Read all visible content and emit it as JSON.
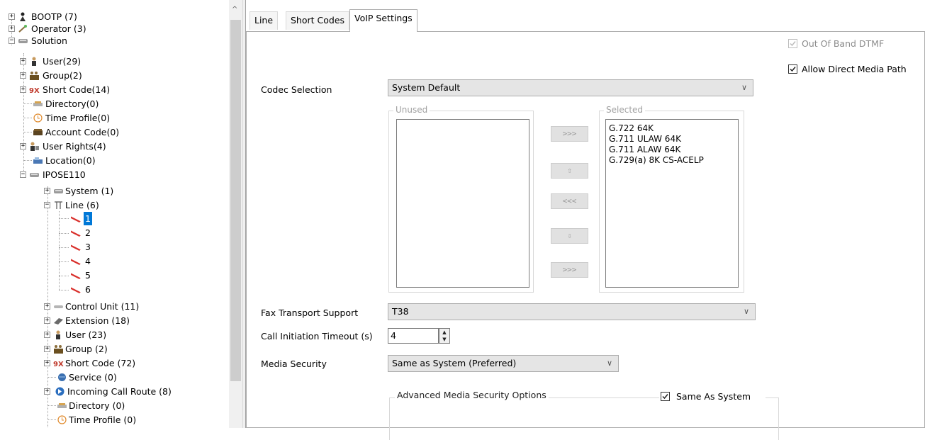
{
  "tree": {
    "root_items": [
      {
        "label": "BOOTP (7)",
        "icon": "bootp-icon"
      },
      {
        "label": "Operator (3)",
        "icon": "operator-icon"
      },
      {
        "label": "Solution",
        "icon": "solution-icon"
      }
    ],
    "solution_children": [
      {
        "label": "User(29)",
        "icon": "user-icon"
      },
      {
        "label": "Group(2)",
        "icon": "group-icon"
      },
      {
        "label": "Short Code(14)",
        "icon": "short-code-icon"
      },
      {
        "label": "Directory(0)",
        "icon": "directory-icon"
      },
      {
        "label": "Time Profile(0)",
        "icon": "time-profile-icon"
      },
      {
        "label": "Account Code(0)",
        "icon": "account-code-icon"
      },
      {
        "label": "User Rights(4)",
        "icon": "user-rights-icon"
      },
      {
        "label": "Location(0)",
        "icon": "location-icon"
      },
      {
        "label": "IPOSE110",
        "icon": "system-icon"
      }
    ],
    "ipose_children": [
      {
        "label": "System (1)",
        "icon": "system-icon"
      },
      {
        "label": "Line (6)",
        "icon": "line-icon"
      }
    ],
    "lines": [
      "1",
      "2",
      "3",
      "4",
      "5",
      "6"
    ],
    "ipose_more": [
      {
        "label": "Control Unit (11)",
        "icon": "control-unit-icon"
      },
      {
        "label": "Extension (18)",
        "icon": "extension-icon"
      },
      {
        "label": "User (23)",
        "icon": "user-icon"
      },
      {
        "label": "Group (2)",
        "icon": "group-icon"
      },
      {
        "label": "Short Code (72)",
        "icon": "short-code-icon"
      },
      {
        "label": "Service (0)",
        "icon": "service-icon"
      },
      {
        "label": "Incoming Call Route (8)",
        "icon": "incoming-call-route-icon"
      },
      {
        "label": "Directory (0)",
        "icon": "directory-icon"
      },
      {
        "label": "Time Profile (0)",
        "icon": "time-profile-icon"
      }
    ]
  },
  "tabs": [
    "Line",
    "Short Codes",
    "VoIP Settings"
  ],
  "active_tab": "VoIP Settings",
  "voip": {
    "out_of_band_dtmf": {
      "label": "Out Of Band DTMF",
      "checked": true,
      "disabled": true
    },
    "allow_direct_media": {
      "label": "Allow Direct Media Path",
      "checked": true
    },
    "codec_selection_label": "Codec Selection",
    "codec_selection_value": "System Default",
    "unused_title": "Unused",
    "selected_title": "Selected",
    "selected_codecs": [
      "G.722 64K",
      "G.711 ULAW 64K",
      "G.711 ALAW 64K",
      "G.729(a) 8K CS-ACELP"
    ],
    "buttons": {
      "add_all": ">>>",
      "up": "⇧",
      "remove_all": "<<<",
      "down": "⇩",
      "add": ">>>"
    },
    "fax_label": "Fax Transport Support",
    "fax_value": "T38",
    "timeout_label": "Call Initiation Timeout (s)",
    "timeout_value": "4",
    "media_security_label": "Media Security",
    "media_security_value": "Same as System (Preferred)",
    "advanced_title": "Advanced Media Security Options",
    "same_as_system": {
      "label": "Same As System",
      "checked": true
    }
  },
  "colors": {
    "selection": "#0078d7",
    "line_icon": "#d9302c"
  }
}
